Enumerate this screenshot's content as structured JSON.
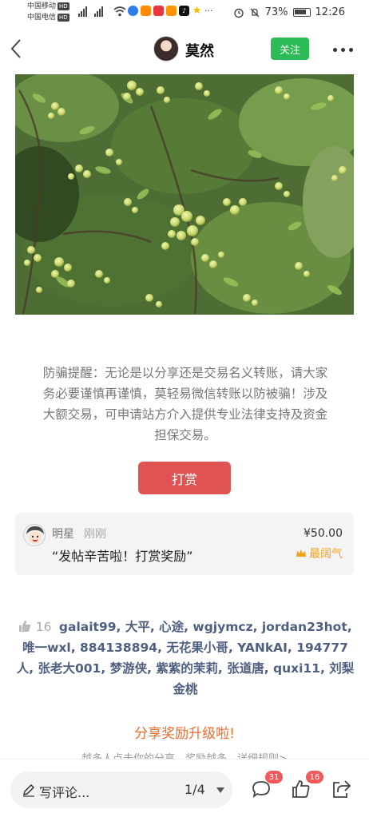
{
  "status_bar": {
    "carrier1": "中国移动",
    "carrier2": "中国电信",
    "hd": "HD",
    "battery_percent": "73%",
    "time": "12:26"
  },
  "header": {
    "author_name": "莫然",
    "follow_label": "关注"
  },
  "warning_text": "防骗提醒：无论是以分享还是交易名义转账，请大家务必要谨慎再谨慎，莫轻易微信转账以防被骗！涉及大额交易，可申请站方介入提供专业法律支持及资金担保交易。",
  "reward_button_label": "打赏",
  "reward_card": {
    "name": "明星",
    "time": "刚刚",
    "message": "“发帖辛苦啦！打赏奖励”",
    "amount": "¥50.00",
    "badge": "最阔气"
  },
  "likers": {
    "count": "16",
    "names_text": "galait99, 大平, 心途, wgjymcz, jordan23hot, 唯一wxl, 884138894, 无花果小哥, YANkAI, 194777人, 张老大001, 梦游侠, 紫紫的茉莉, 张道唐, quxi11, 刘梨金桃"
  },
  "upgrade": {
    "title": "分享奖励升级啦!",
    "subtitle": "越多人点击你的分享，奖励越多，详细规则>"
  },
  "bottom_bar": {
    "comment_placeholder": "写评论...",
    "page_indicator": "1/4",
    "comment_count": "31",
    "like_count": "16"
  },
  "colors": {
    "follow_green": "#2dbb55",
    "reward_red": "#e05454",
    "liker_blue": "#4f5f82",
    "upgrade_orange": "#ef6a2c",
    "badge_gold": "#f2a21a"
  }
}
